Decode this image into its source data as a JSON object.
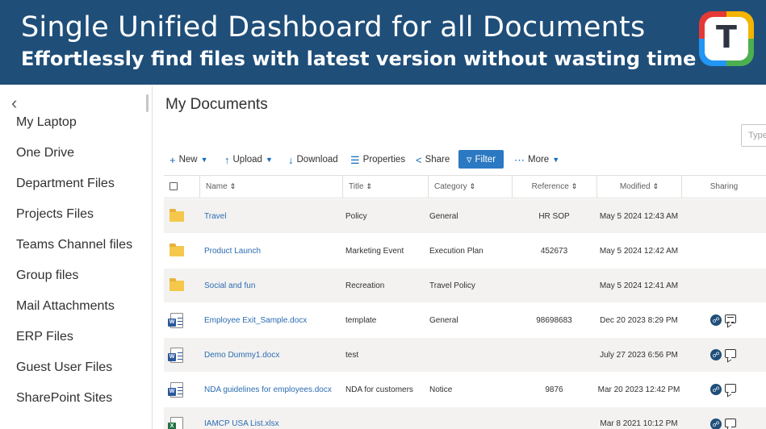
{
  "banner": {
    "title": "Single Unified Dashboard for all Documents",
    "subtitle": "Effortlessly find files with latest version without wasting time",
    "logo_letter": "T"
  },
  "sidebar": {
    "items": [
      {
        "label": "My Laptop"
      },
      {
        "label": "One Drive"
      },
      {
        "label": "Department Files"
      },
      {
        "label": "Projects Files"
      },
      {
        "label": "Teams Channel files"
      },
      {
        "label": "Group files"
      },
      {
        "label": "Mail Attachments"
      },
      {
        "label": "ERP Files"
      },
      {
        "label": "Guest User Files"
      },
      {
        "label": "SharePoint Sites"
      }
    ]
  },
  "main": {
    "title": "My Documents",
    "search_placeholder": "Type"
  },
  "toolbar": {
    "new_label": "New",
    "upload_label": "Upload",
    "download_label": "Download",
    "properties_label": "Properties",
    "share_label": "Share",
    "filter_label": "Filter",
    "more_label": "More"
  },
  "table": {
    "columns": {
      "name": "Name",
      "title": "Title",
      "category": "Category",
      "reference": "Reference",
      "modified": "Modified",
      "sharing": "Sharing"
    },
    "rows": [
      {
        "type": "folder",
        "name": "Travel",
        "title": "Policy",
        "category": "General",
        "reference": "HR SOP",
        "modified": "May 5 2024 12:43 AM",
        "sharing": "none"
      },
      {
        "type": "folder",
        "name": "Product Launch",
        "title": "Marketing Event",
        "category": "Execution Plan",
        "reference": "452673",
        "modified": "May 5 2024 12:42 AM",
        "sharing": "none"
      },
      {
        "type": "folder",
        "name": "Social and fun",
        "title": "Recreation",
        "category": "Travel Policy",
        "reference": "",
        "modified": "May 5 2024 12:41 AM",
        "sharing": "none"
      },
      {
        "type": "word",
        "name": "Employee Exit_Sample.docx",
        "title": "template",
        "category": "General",
        "reference": "98698683",
        "modified": "Dec 20 2023 8:29 PM",
        "sharing": "shared-with-comments"
      },
      {
        "type": "word",
        "name": "Demo Dummy1.docx",
        "title": "test",
        "category": "",
        "reference": "",
        "modified": "July 27 2023 6:56 PM",
        "sharing": "shared"
      },
      {
        "type": "word",
        "name": "NDA guidelines for employees.docx",
        "title": "NDA for customers",
        "category": "Notice",
        "reference": "9876",
        "modified": "Mar 20 2023 12:42 PM",
        "sharing": "shared"
      },
      {
        "type": "excel",
        "name": "IAMCP USA List.xlsx",
        "title": "",
        "category": "",
        "reference": "",
        "modified": "Mar 8 2021 10:12 PM",
        "sharing": "shared"
      }
    ]
  },
  "colors": {
    "banner_bg": "#1f4e79",
    "accent": "#2b79c2",
    "link": "#2b6cb0",
    "row_alt": "#f3f2f1"
  }
}
